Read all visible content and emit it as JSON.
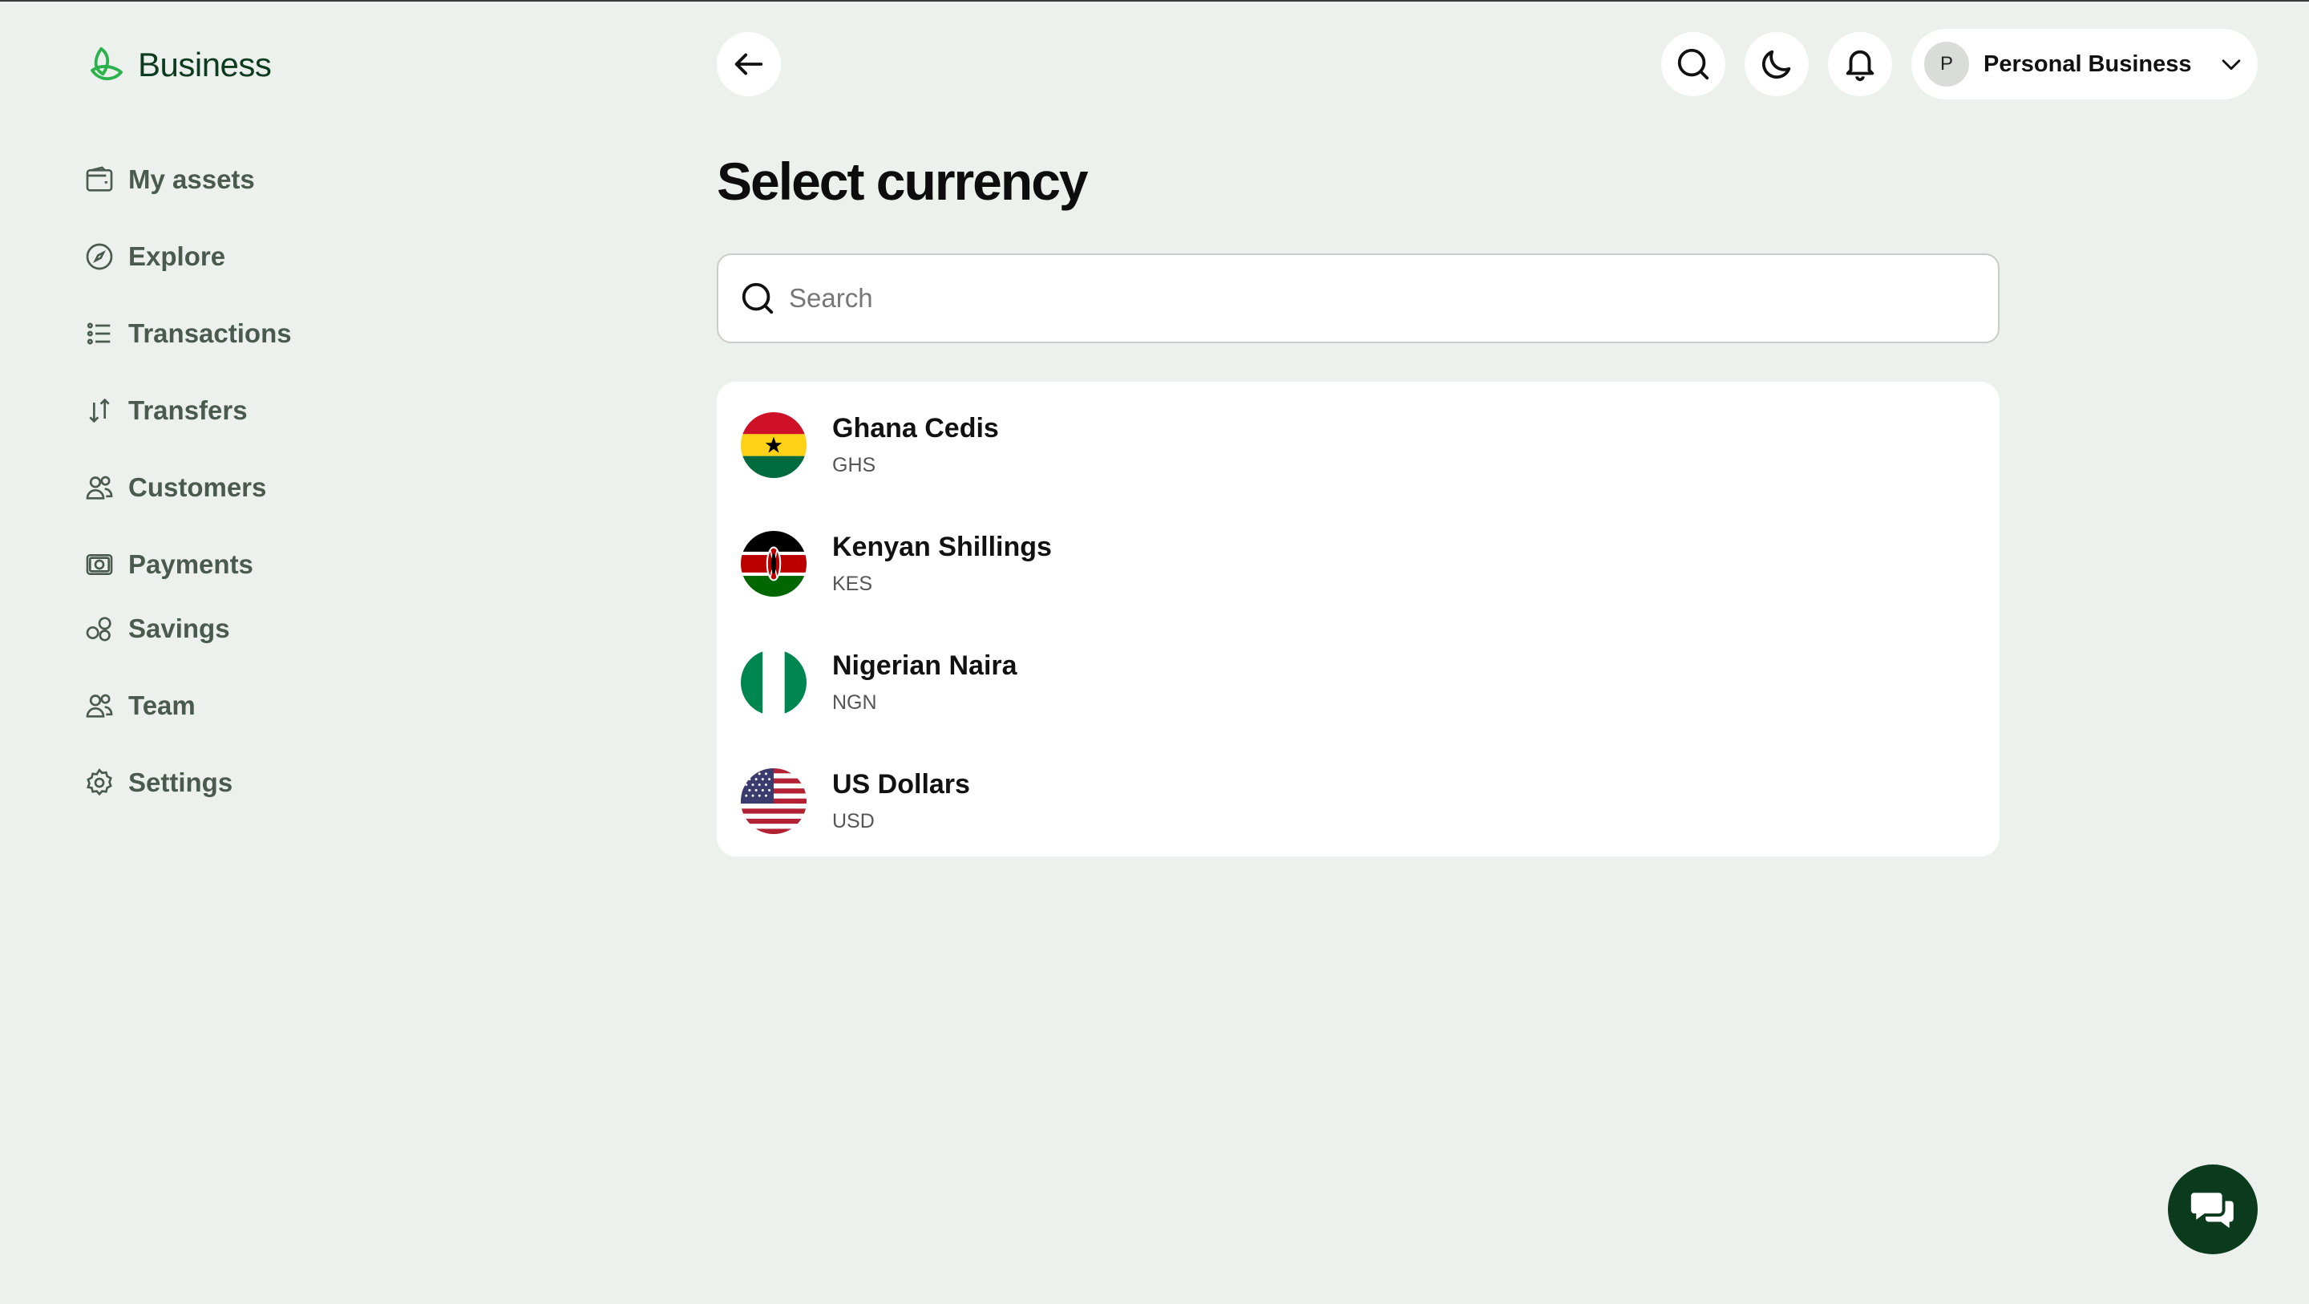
{
  "brand": {
    "name": "Business",
    "accent": "#2bb24c"
  },
  "sidebar": {
    "items": [
      {
        "label": "My assets",
        "icon": "wallet-icon"
      },
      {
        "label": "Explore",
        "icon": "compass-icon"
      },
      {
        "label": "Transactions",
        "icon": "list-icon"
      },
      {
        "label": "Transfers",
        "icon": "arrows-updown-icon"
      },
      {
        "label": "Customers",
        "icon": "users-icon"
      },
      {
        "label": "Payments",
        "icon": "cash-icon"
      },
      {
        "label": "Savings",
        "icon": "coins-icon"
      },
      {
        "label": "Team",
        "icon": "users-icon"
      },
      {
        "label": "Settings",
        "icon": "gear-icon"
      }
    ]
  },
  "header": {
    "account": {
      "initial": "P",
      "name": "Personal Business"
    }
  },
  "main": {
    "title": "Select currency",
    "search": {
      "placeholder": "Search",
      "value": ""
    },
    "currencies": [
      {
        "name": "Ghana Cedis",
        "code": "GHS",
        "flag": "ghana-flag-icon"
      },
      {
        "name": "Kenyan Shillings",
        "code": "KES",
        "flag": "kenya-flag-icon"
      },
      {
        "name": "Nigerian Naira",
        "code": "NGN",
        "flag": "nigeria-flag-icon"
      },
      {
        "name": "US Dollars",
        "code": "USD",
        "flag": "usa-flag-icon"
      }
    ]
  },
  "colors": {
    "background": "#edf1ed",
    "chat_button": "#0b3a1d",
    "nav_text": "#4a5a4e"
  }
}
